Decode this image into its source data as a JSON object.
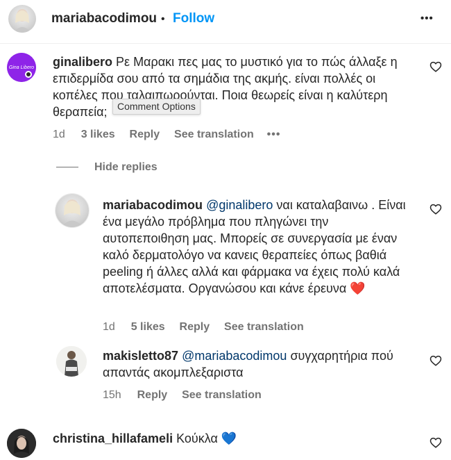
{
  "header": {
    "username": "mariabacodimou",
    "separator": "•",
    "follow_label": "Follow",
    "more_label": "•••"
  },
  "comments": [
    {
      "username": "ginalibero",
      "avatar_text": "Gina Libero",
      "text": "Ρε Μαρακι πες μας το μυστικό για το πώς άλλαξε η επιδερμίδα σου από τα σημάδια της ακμής. είναι πολλές οι κοπέλες που ταλαιπωρούνται. Ποια θεωρείς είναι η καλύτερη θεραπεία;",
      "time": "1d",
      "likes": "3 likes",
      "reply": "Reply",
      "translation": "See translation",
      "options_dots": "•••",
      "tooltip": "Comment Options",
      "hide_replies": "Hide replies"
    },
    {
      "username": "mariabacodimou",
      "mention": "@ginalibero",
      "text": "ναι καταλαβαινω . Είναι ένα μεγάλο πρόβλημα που πληγώνει την αυτοπεποιθηση μας. Μπορείς σε συνεργασία με έναν καλό δερματολόγο να κανεις θεραπείες όπως βαθιά peeling ή άλλες αλλά και φάρμακα να έχεις πολύ καλά αποτελέσματα. Οργανώσου και κάνε έρευνα ❤️",
      "time": "1d",
      "likes": "5 likes",
      "reply": "Reply",
      "translation": "See translation"
    },
    {
      "username": "makisletto87",
      "mention": "@mariabacodimou",
      "text": "συγχαρητήρια πού απαντάς ακομπλεξαριστα",
      "time": "15h",
      "reply": "Reply",
      "translation": "See translation"
    },
    {
      "username": "christina_hillafameli",
      "text": "Κούκλα 💙"
    }
  ],
  "colors": {
    "follow_blue": "#0095f6",
    "mention_blue": "#00376b",
    "meta_gray": "#737373",
    "gina_purple": "#8e24e8",
    "heart_red": "#e0202e"
  }
}
